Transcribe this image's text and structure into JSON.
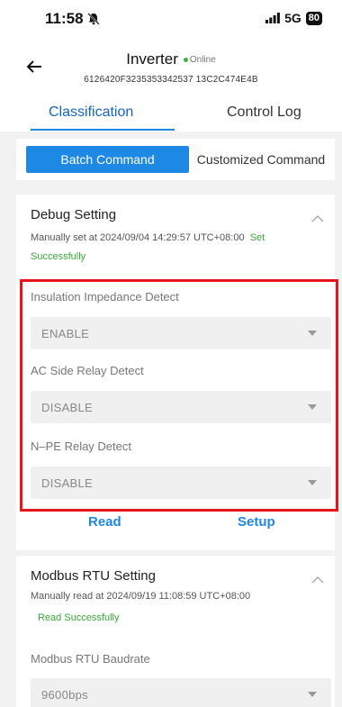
{
  "status_bar": {
    "time": "11:58",
    "network": "5G",
    "battery": "80"
  },
  "header": {
    "title": "Inverter",
    "online": "Online",
    "serial": "6126420F3235353342537 13C2C474E4B",
    "tabs": [
      {
        "label": "Classification",
        "active": true
      },
      {
        "label": "Control Log",
        "active": false
      }
    ]
  },
  "commands": {
    "batch": "Batch Command",
    "customized": "Customized Command"
  },
  "debug": {
    "title": "Debug Setting",
    "meta_prefix": "Manually set at 2024/09/04 14:29:57 UTC+08:00",
    "meta_status_a": "Set",
    "meta_status_b": "Successfully",
    "fields": [
      {
        "label": "Insulation Impedance Detect",
        "value": "ENABLE"
      },
      {
        "label": "AC Side Relay Detect",
        "value": "DISABLE"
      },
      {
        "label": "N–PE Relay Detect",
        "value": "DISABLE"
      }
    ],
    "read_label": "Read",
    "setup_label": "Setup"
  },
  "modbus": {
    "title": "Modbus RTU Setting",
    "meta": "Manually read at 2024/09/19 11:08:59 UTC+08:00",
    "status": "Read Successfully",
    "field_label": "Modbus RTU Baudrate",
    "field_value": "9600bps"
  },
  "colors": {
    "accent": "#1e88e5",
    "highlight": "#e8141b",
    "success": "#3aa63a"
  }
}
